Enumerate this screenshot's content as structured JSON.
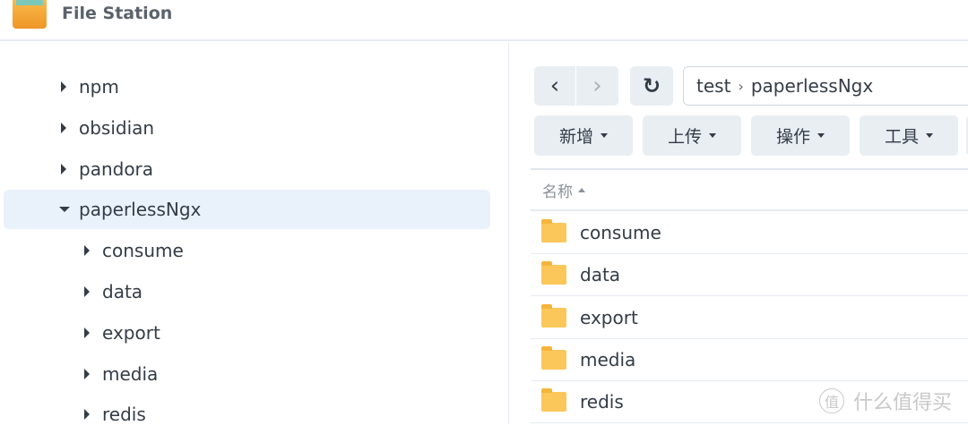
{
  "app": {
    "title": "File Station"
  },
  "tree": [
    {
      "label": "npm",
      "level": 0,
      "expanded": false
    },
    {
      "label": "obsidian",
      "level": 0,
      "expanded": false
    },
    {
      "label": "pandora",
      "level": 0,
      "expanded": false
    },
    {
      "label": "paperlessNgx",
      "level": 0,
      "expanded": true,
      "selected": true
    },
    {
      "label": "consume",
      "level": 1,
      "expanded": false
    },
    {
      "label": "data",
      "level": 1,
      "expanded": false
    },
    {
      "label": "export",
      "level": 1,
      "expanded": false
    },
    {
      "label": "media",
      "level": 1,
      "expanded": false
    },
    {
      "label": "redis",
      "level": 1,
      "expanded": false
    }
  ],
  "path": {
    "segments": [
      "test",
      "paperlessNgx"
    ],
    "separator": "›"
  },
  "toolbar": {
    "buttons": [
      "新增",
      "上传",
      "操作",
      "工具"
    ]
  },
  "list": {
    "column_name": "名称",
    "sort": "ascending",
    "items": [
      "consume",
      "data",
      "export",
      "media",
      "redis"
    ]
  },
  "watermark": {
    "badge": "值",
    "text": "什么值得买"
  }
}
